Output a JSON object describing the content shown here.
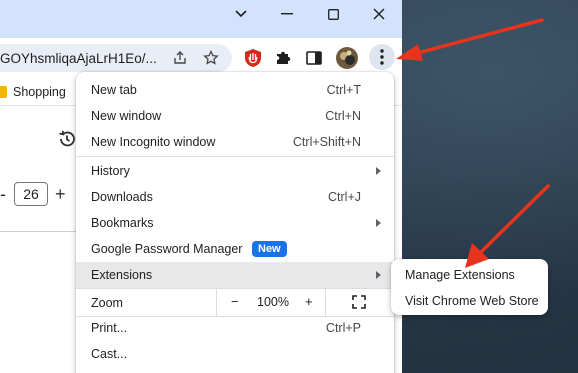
{
  "window": {
    "controls": {
      "minimize_icon": "minimize-icon",
      "maximize_icon": "maximize-icon",
      "close_icon": "close-icon",
      "dropdown_icon": "chevron-down-icon"
    }
  },
  "toolbar": {
    "address_text": "GOYhsmliqaAjaLrH1Eo/...",
    "icons": [
      "share-icon",
      "star-icon",
      "ublock-icon",
      "puzzle-icon",
      "sidepanel-icon",
      "avatar",
      "menu-kebab-icon"
    ]
  },
  "bookmarks_bar": {
    "items": [
      {
        "label": "Shopping"
      }
    ]
  },
  "page": {
    "stepper_value": "26",
    "stepper_minus": "-",
    "stepper_plus": "+"
  },
  "menu": {
    "items": [
      {
        "label": "New tab",
        "shortcut": "Ctrl+T"
      },
      {
        "label": "New window",
        "shortcut": "Ctrl+N"
      },
      {
        "label": "New Incognito window",
        "shortcut": "Ctrl+Shift+N"
      },
      {
        "label": "History",
        "shortcut": ""
      },
      {
        "label": "Downloads",
        "shortcut": "Ctrl+J"
      },
      {
        "label": "Bookmarks",
        "shortcut": ""
      },
      {
        "label": "Google Password Manager",
        "shortcut": "",
        "badge": "New"
      },
      {
        "label": "Extensions",
        "shortcut": ""
      },
      {
        "label": "Zoom",
        "shortcut": ""
      },
      {
        "label": "Print...",
        "shortcut": "Ctrl+P"
      },
      {
        "label": "Cast...",
        "shortcut": ""
      }
    ],
    "zoom": {
      "minus": "−",
      "value": "100%",
      "plus": "+"
    }
  },
  "submenu": {
    "items": [
      {
        "label": "Manage Extensions"
      },
      {
        "label": "Visit Chrome Web Store"
      }
    ]
  },
  "colors": {
    "accent": "#1a73e8",
    "annotation_arrow": "#e8341c",
    "titlebar": "#d3e3fd"
  }
}
